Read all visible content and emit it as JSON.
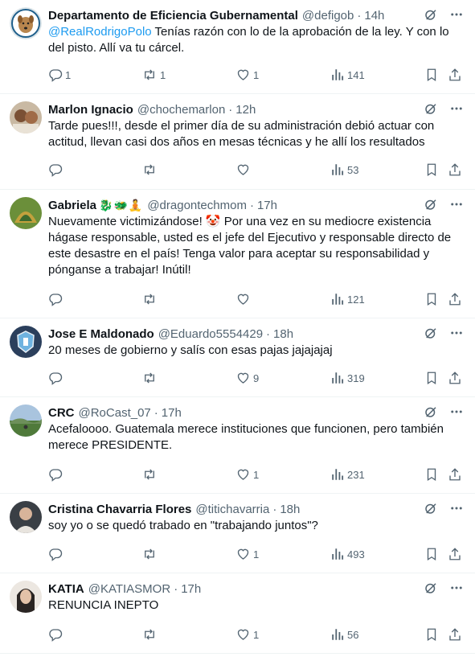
{
  "tweets": [
    {
      "name": "Departamento de Eficiencia Gubernamental",
      "emoji": "",
      "handle": "@defigob",
      "time": "14h",
      "mention": "@RealRodrigoPolo",
      "text": " Tenías razón con lo de la aprobación de la ley.  Y con lo del pisto. Allí va tu cárcel.",
      "replies": "1",
      "retweets": "1",
      "likes": "1",
      "views": "141"
    },
    {
      "name": "Marlon Ignacio",
      "emoji": "",
      "handle": "@chochemarlon",
      "time": "12h",
      "mention": "",
      "text": "Tarde pues!!!, desde el primer día de su administración debió actuar con actitud, llevan casi dos años en mesas técnicas y he allí los resultados",
      "replies": "",
      "retweets": "",
      "likes": "",
      "views": "53"
    },
    {
      "name": "Gabriela",
      "emoji": "🐉🐲🧘",
      "handle": "@dragontechmom",
      "time": "17h",
      "mention": "",
      "text": "Nuevamente victimizándose! 🤡 Por una vez en su mediocre existencia hágase responsable, usted es el jefe del Ejecutivo y responsable directo de este desastre en el país! Tenga valor para aceptar su responsabilidad y pónganse a trabajar! Inútil!",
      "replies": "",
      "retweets": "",
      "likes": "",
      "views": "121"
    },
    {
      "name": "Jose E Maldonado",
      "emoji": "",
      "handle": "@Eduardo5554429",
      "time": "18h",
      "mention": "",
      "text": "20 meses de gobierno y salís con esas pajas jajajajaj",
      "replies": "",
      "retweets": "",
      "likes": "9",
      "views": "319"
    },
    {
      "name": "CRC",
      "emoji": "",
      "handle": "@RoCast_07",
      "time": "17h",
      "mention": "",
      "text": "Acefaloooo. Guatemala merece instituciones que funcionen, pero también merece PRESIDENTE.",
      "replies": "",
      "retweets": "",
      "likes": "1",
      "views": "231"
    },
    {
      "name": "Cristina Chavarria Flores",
      "emoji": "",
      "handle": "@titichavarria",
      "time": "18h",
      "mention": "",
      "text": "soy yo o se quedó trabado en \"trabajando juntos\"?",
      "replies": "",
      "retweets": "",
      "likes": "1",
      "views": "493"
    },
    {
      "name": "KATIA",
      "emoji": "",
      "handle": "@KATIASMOR",
      "time": "17h",
      "mention": "",
      "text": "RENUNCIA INEPTO",
      "replies": "",
      "retweets": "",
      "likes": "1",
      "views": "56"
    }
  ],
  "separator": "·",
  "icons": [
    "grok-icon",
    "more-icon",
    "reply-icon",
    "retweet-icon",
    "like-icon",
    "views-icon",
    "bookmark-icon",
    "share-icon"
  ],
  "colors": {
    "text": "#0f1419",
    "secondary": "#536471",
    "link": "#1d9bf0",
    "border": "#eff3f4"
  }
}
